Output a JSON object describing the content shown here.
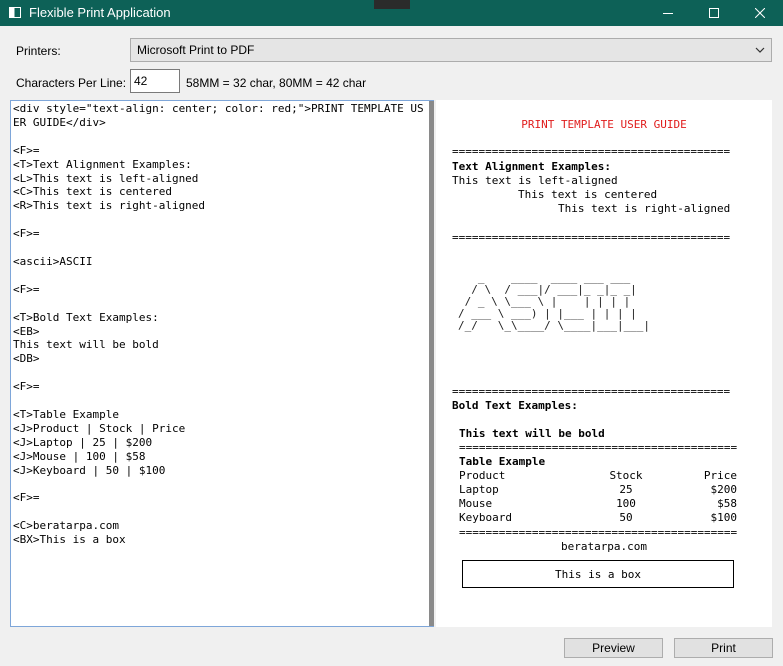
{
  "window": {
    "title": "Flexible Print Application",
    "icons": [
      "app-icon",
      "minimize-icon",
      "maximize-icon",
      "close-icon"
    ]
  },
  "form": {
    "printers_label": "Printers:",
    "printer_selected": "Microsoft Print to PDF",
    "cpl_label": "Characters Per Line:",
    "cpl_value": "42",
    "cpl_hint": "58MM = 32 char, 80MM = 42 char"
  },
  "editor": {
    "text": "<div style=\"text-align: center; color: red;\">PRINT TEMPLATE USER GUIDE</div>\n\n<F>=\n<T>Text Alignment Examples:\n<L>This text is left-aligned\n<C>This text is centered\n<R>This text is right-aligned\n\n<F>=\n\n<ascii>ASCII\n\n<F>=\n\n<T>Bold Text Examples:\n<EB>\nThis text will be bold\n<DB>\n\n<F>=\n\n<T>Table Example\n<J>Product | Stock | Price\n<J>Laptop | 25 | $200\n<J>Mouse | 100 | $58\n<J>Keyboard | 50 | $100\n\n<F>=\n\n<C>beratarpa.com\n<BX>This is a box"
  },
  "preview": {
    "title": "PRINT TEMPLATE USER GUIDE",
    "title_color": "#e01d1d",
    "separator": "==========================================",
    "alignment_heading": "Text Alignment Examples:",
    "left_text": "This text is left-aligned",
    "center_text": "This text is centered",
    "right_text": "This text is right-aligned",
    "ascii_art": "   _    ____  ____ ___ ___\n  / \\  / ___|/ ___|_ _|_ _|\n / _ \\ \\___ \\ |    | | | |\n/ ___ \\ ___) | |___ | | | |\n/_/   \\_\\____/ \\____|___|___|",
    "bold_heading": "Bold Text Examples:",
    "bold_text": "This text will be bold",
    "table_heading": "Table Example",
    "table": {
      "headers": [
        "Product",
        "Stock",
        "Price"
      ],
      "rows": [
        [
          "Laptop",
          "25",
          "$200"
        ],
        [
          "Mouse",
          "100",
          "$58"
        ],
        [
          "Keyboard",
          "50",
          "$100"
        ]
      ]
    },
    "center_url": "beratarpa.com",
    "box_text": "This is a box"
  },
  "buttons": {
    "preview": "Preview",
    "print": "Print"
  },
  "colors": {
    "titlebar": "#0d6157",
    "editor_border": "#7ea6d9",
    "scrollbar_thumb": "#8a8a8a"
  }
}
